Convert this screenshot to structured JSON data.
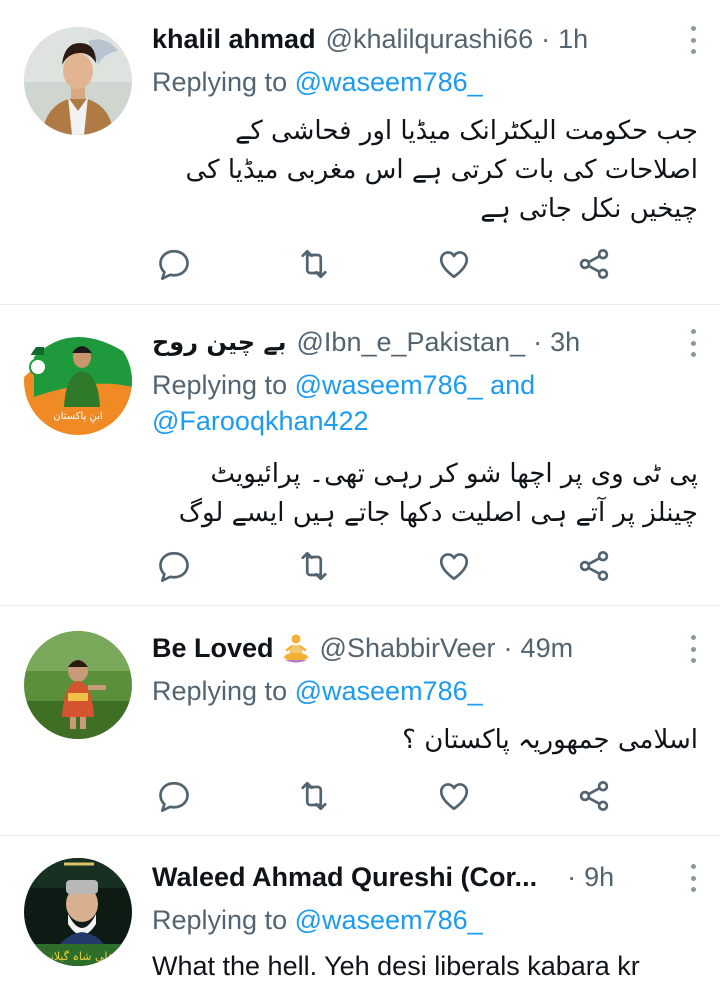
{
  "tweets": [
    {
      "name": "khalil ahmad",
      "handle": "@khalilqurashi66",
      "separator": "·",
      "time": "1h",
      "replying_prefix": "Replying to",
      "replying_to": "@waseem786_",
      "replying_and": "",
      "replying_to_2": "",
      "text": "جب حکومت الیکٹرانک میڈیا اور فحاشی کے اصلاحات کی بات کرتی ہے اس مغربی میڈیا کی چیخیں نکل جاتی ہے"
    },
    {
      "name": "بے چین روح",
      "handle": "@Ibn_e_Pakistan_",
      "separator": "·",
      "time": "3h",
      "replying_prefix": "Replying to",
      "replying_to": "@waseem786_",
      "replying_and": "and",
      "replying_to_2": "@Farooqkhan422",
      "text": "پی ٹی وی پر اچھا شو کر رہی تھی۔ پرائیویٹ چینلز پر آتے ہی اصلیت دکھا جاتے ہیں ایسے لوگ",
      "avatar_text": "ابنِ پاکستان"
    },
    {
      "name": "Be Loved",
      "handle": "@ShabbirVeer",
      "separator": "·",
      "time": "49m",
      "replying_prefix": "Replying to",
      "replying_to": "@waseem786_",
      "replying_and": "",
      "replying_to_2": "",
      "text": "اسلامی جمھوریہ پاکستان ؟",
      "name_emoji": "person-in-lotus-position"
    },
    {
      "name": "Waleed Ahmad Qureshi (Cor...",
      "handle": "",
      "separator": "·",
      "time": "9h",
      "replying_prefix": "Replying to",
      "replying_to": "@waseem786_",
      "replying_and": "",
      "replying_to_2": "",
      "text": "What the hell. Yeh desi liberals kabara kr",
      "avatar_text": "علی شاہ گیلانی"
    }
  ],
  "icons": {
    "reply": "reply-icon",
    "retweet": "retweet-icon",
    "like": "like-icon",
    "share": "share-icon",
    "more": "more-options-icon"
  },
  "colors": {
    "accent": "#1d9bf0",
    "secondary_text": "#536471",
    "icon": "#536471",
    "divider": "#e6ecf0"
  }
}
